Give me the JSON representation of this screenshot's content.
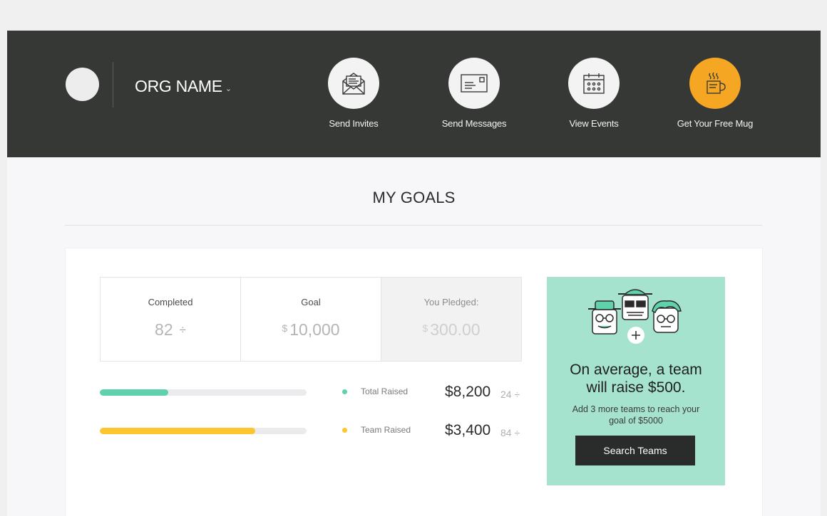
{
  "header": {
    "org_name": "ORG NAME",
    "org_chevron": "⌄",
    "nav": [
      {
        "label": "Send Invites",
        "icon": "envelope-open-icon"
      },
      {
        "label": "Send Messages",
        "icon": "envelope-icon"
      },
      {
        "label": "View Events",
        "icon": "calendar-icon"
      },
      {
        "label": "Get Your Free Mug",
        "icon": "mug-icon"
      }
    ]
  },
  "page": {
    "title": "MY GOALS"
  },
  "stats": {
    "completed": {
      "label": "Completed",
      "value": "82",
      "suffix": "÷"
    },
    "goal": {
      "label": "Goal",
      "currency": "$",
      "value": "10,000"
    },
    "pledged": {
      "label": "You Pledged:",
      "currency": "$",
      "value": "300.00"
    }
  },
  "raised": [
    {
      "label": "Total Raised",
      "amount": "$8,200",
      "count": "24",
      "count_suffix": "÷",
      "progress_percent": 33,
      "color": "#5fd1ac"
    },
    {
      "label": "Team Raised",
      "amount": "$3,400",
      "count": "84",
      "count_suffix": "÷",
      "progress_percent": 75,
      "color": "#fdc62e"
    }
  ],
  "promo": {
    "title_line1": "On average, a team",
    "title_line2": "will raise $500.",
    "subtitle_line1": "Add 3 more teams to reach your",
    "subtitle_line2": "goal of $5000",
    "button_label": "Search Teams",
    "background": "#a5e3cf"
  },
  "colors": {
    "header_bg": "#363836",
    "accent_orange": "#f5a623",
    "total_raised": "#5fd1ac",
    "team_raised": "#fdc62e"
  }
}
